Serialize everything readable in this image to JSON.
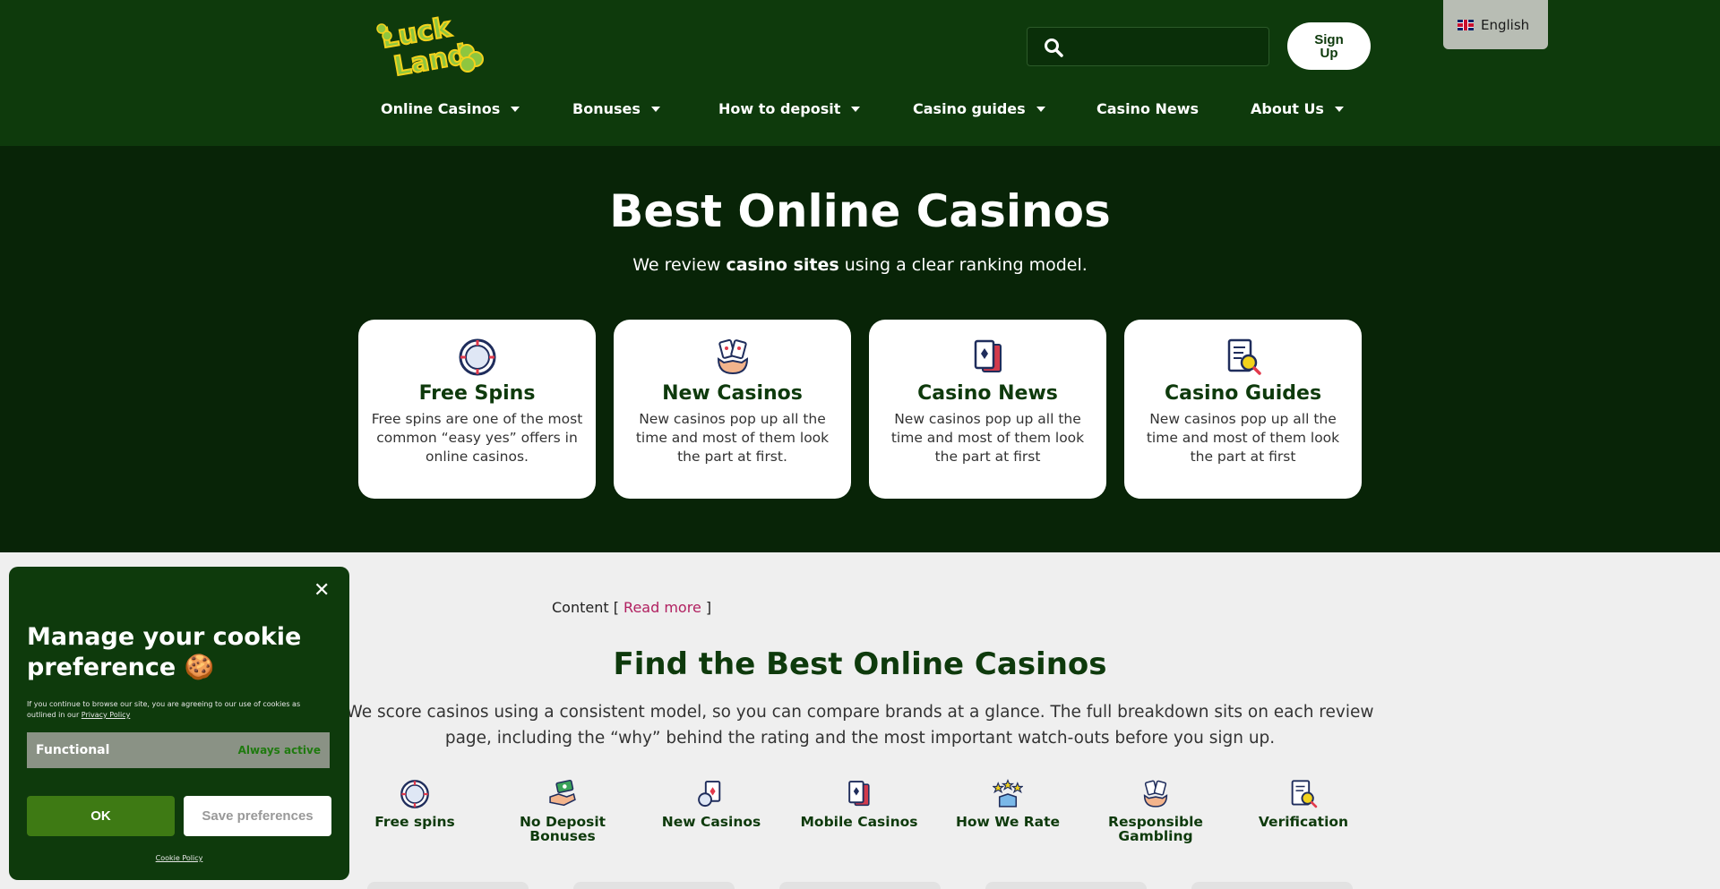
{
  "header": {
    "logo_alt": "Luck Land",
    "search_placeholder": "",
    "signup_label": "Sign\nUp",
    "language": "English"
  },
  "nav": {
    "items": [
      {
        "label": "Online Casinos",
        "dropdown": true
      },
      {
        "label": "Bonuses",
        "dropdown": true
      },
      {
        "label": "How to deposit",
        "dropdown": true
      },
      {
        "label": "Casino guides",
        "dropdown": true
      },
      {
        "label": "Casino News",
        "dropdown": false
      },
      {
        "label": "About Us",
        "dropdown": true
      }
    ]
  },
  "hero": {
    "title": "Best Online Casinos",
    "subtitle_pre": "We review ",
    "subtitle_bold": "casino sites",
    "subtitle_post": " using a clear ranking model."
  },
  "cards": [
    {
      "title": "Free Spins",
      "text": "Free spins are one of the most common “easy yes” offers in online casinos.",
      "icon": "roulette-chip-icon"
    },
    {
      "title": "New Casinos",
      "text": "New casinos pop up all the time and most of them look the part at first.",
      "icon": "hand-cards-icon"
    },
    {
      "title": "Casino News",
      "text": "New casinos pop up all the time and most of them look the part at first",
      "icon": "playing-cards-icon"
    },
    {
      "title": "Casino Guides",
      "text": "New casinos pop up all the time and most of them look the part at first",
      "icon": "checklist-magnifier-icon"
    }
  ],
  "content": {
    "label": "Content [ ",
    "read_more": "Read more",
    "label_end": " ]",
    "find_title": "Find the Best Online Casinos",
    "find_text": "We score casinos using a consistent model, so you can compare brands at a glance. The full breakdown sits on each review page, including the “why” behind the rating and the most important watch-outs before you sign up."
  },
  "categories": [
    {
      "label": "Free spins",
      "icon": "roulette-chip-icon"
    },
    {
      "label": "No Deposit Bonuses",
      "icon": "hand-money-icon"
    },
    {
      "label": "New Casinos",
      "icon": "cards-chip-icon"
    },
    {
      "label": "Mobile Casinos",
      "icon": "playing-cards-icon"
    },
    {
      "label": "How We Rate",
      "icon": "stars-rating-icon"
    },
    {
      "label": "Responsible Gambling",
      "icon": "hand-cards-icon"
    },
    {
      "label": "Verification",
      "icon": "checklist-magnifier-icon"
    }
  ],
  "cookie": {
    "title": "Manage your cookie preference 🍪",
    "text": "If you continue to browse our site, you are agreeing to our use of cookies as outlined in our ",
    "privacy_link": "Privacy Policy",
    "row_name": "Functional",
    "row_status": "Always active",
    "ok_label": "OK",
    "save_label": "Save preferences",
    "policy_link": "Cookie Policy"
  },
  "colors": {
    "header_bg": "#0e3a0c",
    "hero_bg": "#082407",
    "accent_green": "#3e7a14",
    "link_pink": "#b12060"
  }
}
